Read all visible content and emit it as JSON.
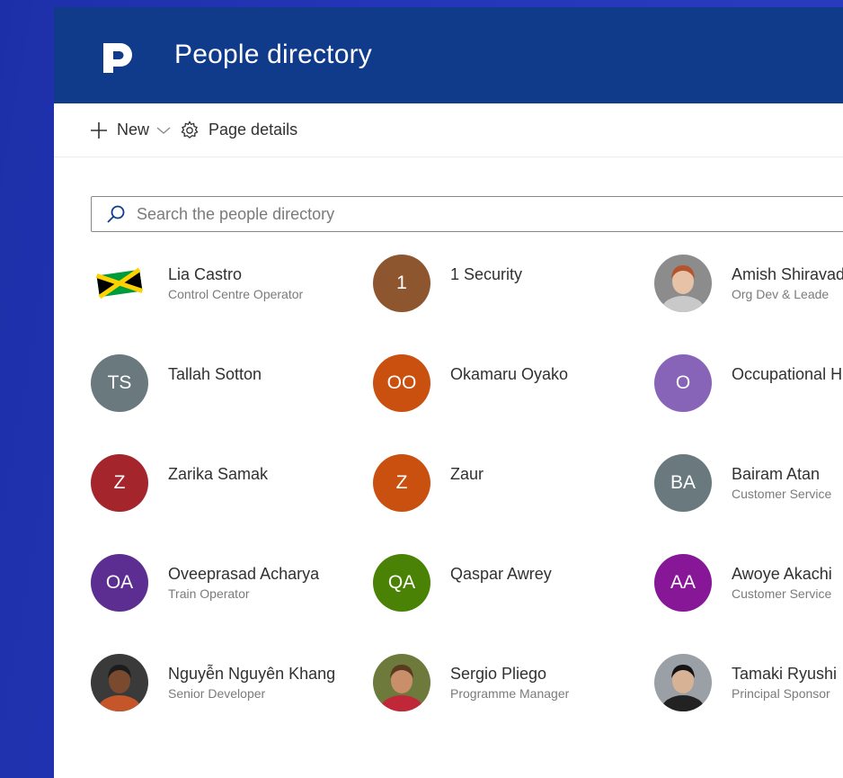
{
  "app": {
    "title": "People directory"
  },
  "commandbar": {
    "new_label": "New",
    "page_details_label": "Page details"
  },
  "search": {
    "placeholder": "Search the people directory"
  },
  "people": [
    {
      "name": "Lia Castro",
      "role": "Control Centre Operator",
      "avatar": {
        "type": "image",
        "icon": "jamaica-flag"
      }
    },
    {
      "name": "1 Security",
      "role": "",
      "avatar": {
        "type": "initials",
        "initials": "1",
        "color": "#8e562e"
      }
    },
    {
      "name": "Amish Shiravad",
      "role": "Org Dev & Leade",
      "avatar": {
        "type": "image",
        "icon": "person-photo"
      }
    },
    {
      "name": "Tallah Sotton",
      "role": "",
      "avatar": {
        "type": "initials",
        "initials": "TS",
        "color": "#69797e"
      }
    },
    {
      "name": "Okamaru Oyako",
      "role": "",
      "avatar": {
        "type": "initials",
        "initials": "OO",
        "color": "#ca5010"
      }
    },
    {
      "name": "Occupational H",
      "role": "",
      "avatar": {
        "type": "initials",
        "initials": "O",
        "color": "#8764b8"
      }
    },
    {
      "name": "Zarika Samak",
      "role": "",
      "avatar": {
        "type": "initials",
        "initials": "Z",
        "color": "#a4262c"
      }
    },
    {
      "name": "Zaur",
      "role": "",
      "avatar": {
        "type": "initials",
        "initials": "Z",
        "color": "#ca5010"
      }
    },
    {
      "name": "Bairam Atan",
      "role": "Customer Service",
      "avatar": {
        "type": "initials",
        "initials": "BA",
        "color": "#69797e"
      }
    },
    {
      "name": "Oveeprasad Acharya",
      "role": "Train Operator",
      "avatar": {
        "type": "initials",
        "initials": "OA",
        "color": "#5c2e91"
      }
    },
    {
      "name": "Qaspar Awrey",
      "role": "",
      "avatar": {
        "type": "initials",
        "initials": "QA",
        "color": "#498205"
      }
    },
    {
      "name": "Awoye Akachi",
      "role": "Customer Service",
      "avatar": {
        "type": "initials",
        "initials": "AA",
        "color": "#881798"
      }
    },
    {
      "name": "Nguyễn Nguyên Khang",
      "role": "Senior Developer",
      "avatar": {
        "type": "image",
        "icon": "person-photo"
      }
    },
    {
      "name": "Sergio Pliego",
      "role": "Programme Manager",
      "avatar": {
        "type": "image",
        "icon": "person-photo"
      }
    },
    {
      "name": "Tamaki Ryushi",
      "role": "Principal Sponsor",
      "avatar": {
        "type": "image",
        "icon": "person-photo"
      }
    }
  ]
}
